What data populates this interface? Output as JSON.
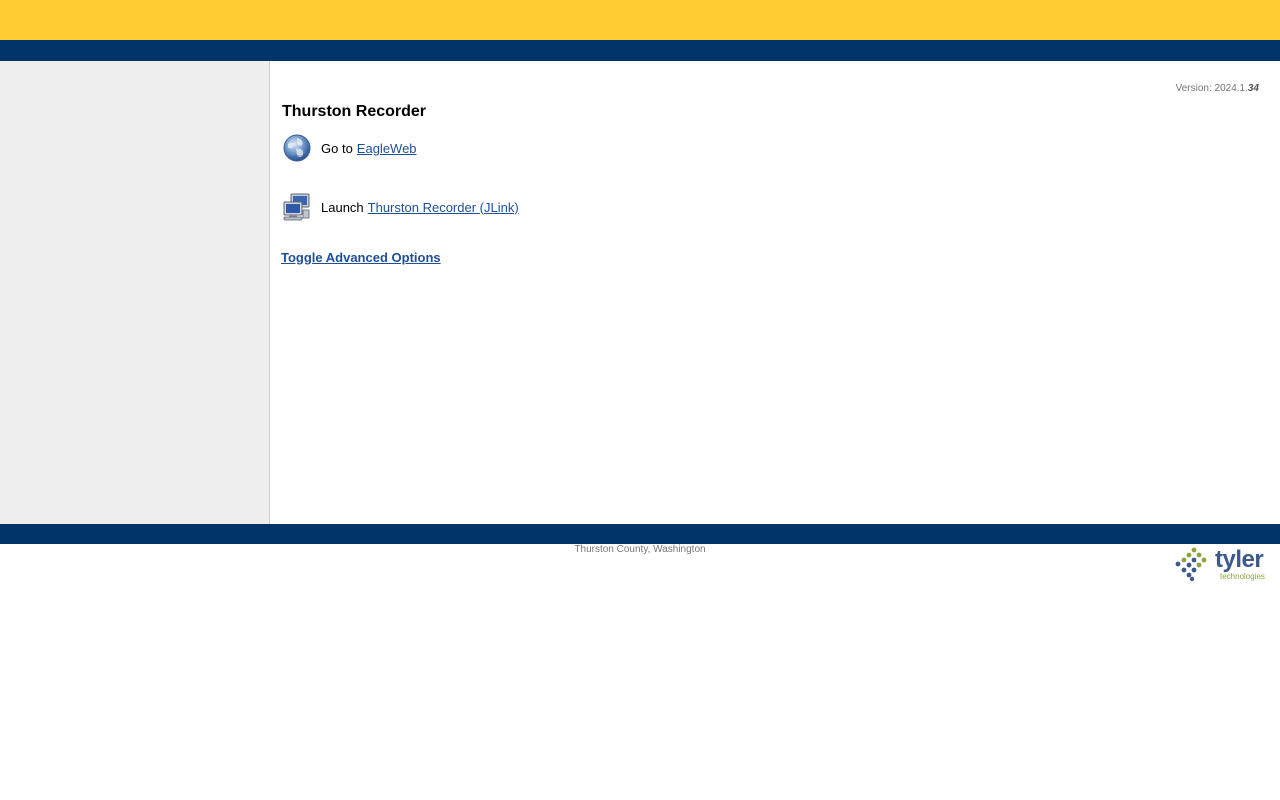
{
  "header": {
    "brand_color": "#ffcc33",
    "nav_color": "#003366"
  },
  "main": {
    "version_label": "Version: 2024.1.",
    "version_build": "34",
    "title": "Thurston Recorder",
    "eagleweb": {
      "icon": "globe-icon",
      "verb": "Go to",
      "link_text": "EagleWeb"
    },
    "jlink": {
      "icon": "computer-network-icon",
      "verb": "Launch",
      "link_text": "Thurston Recorder (JLink)"
    },
    "toggle_label": "Toggle Advanced Options"
  },
  "footer": {
    "county_text": "Thurston County, Washington",
    "logo": {
      "word": "tyler",
      "sub": "technologies",
      "icon": "tyler-logo-icon"
    }
  }
}
